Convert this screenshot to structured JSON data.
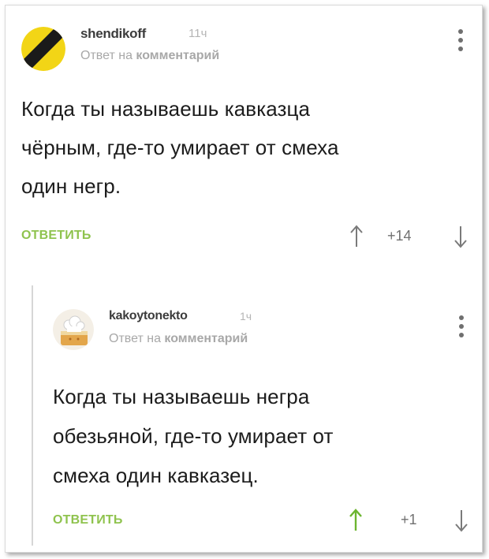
{
  "comments": [
    {
      "username": "shendikoff",
      "time": "11ч",
      "reply_prefix": "Ответ на",
      "reply_target": "комментарий",
      "text_lines": [
        "Когда ты называешь кавказца",
        "чёрным, где-то умирает от смеха",
        "один негр."
      ],
      "reply_button": "ОТВЕТИТЬ",
      "score": "+14",
      "avatar_icon": "yellow-black-striped-avatar-icon"
    },
    {
      "username": "kakoytonekto",
      "time": "1ч",
      "reply_prefix": "Ответ на",
      "reply_target": "комментарий",
      "text_lines": [
        "Когда ты называешь негра",
        "обезьяной, где-то умирает от",
        "смеха один кавказец."
      ],
      "reply_button": "ОТВЕТИТЬ",
      "score": "+1",
      "avatar_icon": "chef-cake-avatar-icon"
    }
  ],
  "colors": {
    "accent_green": "#8fc34e",
    "upvote_active": "#6cb530",
    "arrow_gray": "#7a7a7a"
  }
}
